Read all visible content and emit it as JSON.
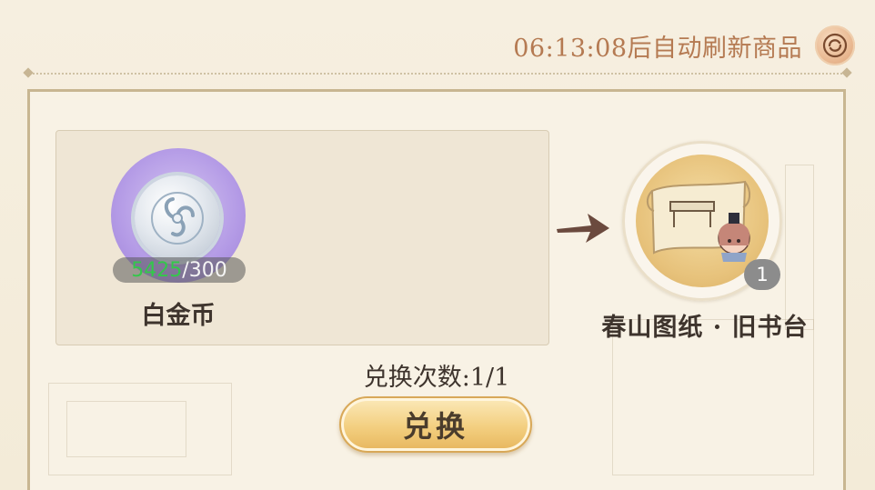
{
  "header": {
    "refresh_text": "06:13:08后自动刷新商品",
    "refresh_icon": "refresh-icon"
  },
  "cost": {
    "item_name": "白金币",
    "owned": "5425",
    "required": "/300",
    "icon": "platinum-coin-icon",
    "colors": {
      "owned": "#33c84a",
      "circle": "#b49be6"
    }
  },
  "reward": {
    "item_name": "春山图纸 · 旧书台",
    "quantity": "1",
    "icon": "blueprint-scroll-icon"
  },
  "exchange": {
    "count_text": "兑换次数:1/1",
    "button_label": "兑换"
  }
}
